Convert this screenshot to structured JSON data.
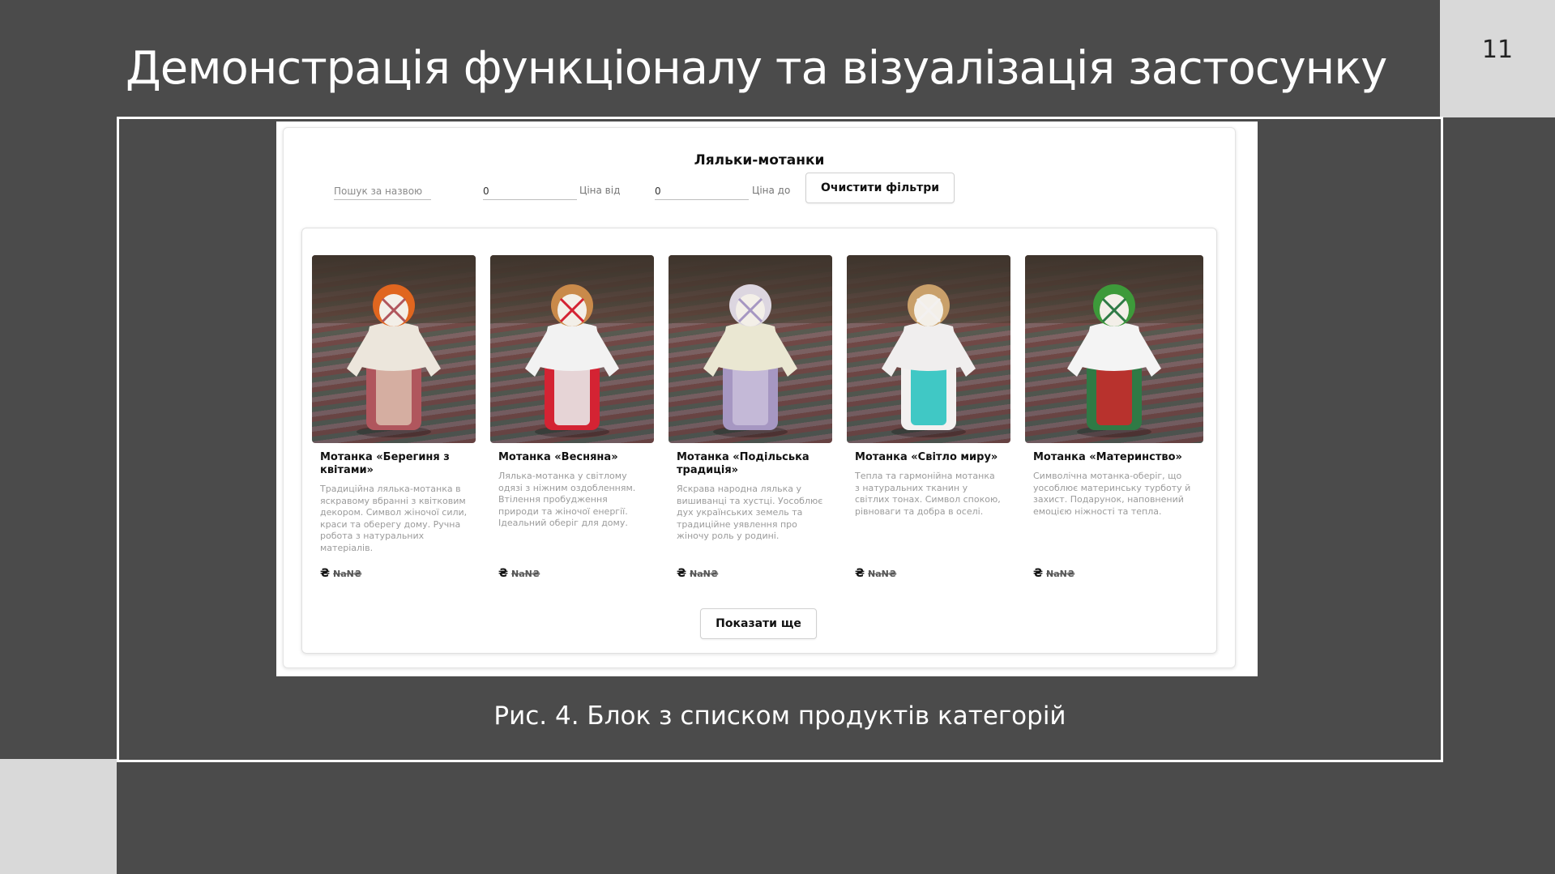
{
  "slide": {
    "title": "Демонстрація функціоналу та візуалізація застосунку",
    "number": "11",
    "caption": "Рис. 4. Блок з списком продуктів категорій"
  },
  "app": {
    "heading": "Ляльки-мотанки",
    "filters": {
      "search_placeholder": "Пошук за назвою",
      "price_from_value": "0",
      "price_from_label": "Ціна від",
      "price_to_value": "0",
      "price_to_label": "Ціна до",
      "clear_label": "Очистити фільтри"
    },
    "products": [
      {
        "name": "Мотанка «Берегиня з квітами»",
        "description": "Традиційна лялька-мотанка в яскравому вбранні з квітковим декором. Символ жіночої сили, краси та оберегу дому. Ручна робота з натуральних матеріалів.",
        "currency_icon": "₴",
        "price": "NaN₴",
        "colors": {
          "hair": "#e0661f",
          "top": "#ece6dc",
          "skirt": "#b0565d",
          "apron": "#d9b8a8"
        }
      },
      {
        "name": "Мотанка «Весняна»",
        "description": "Лялька-мотанка у світлому одязі з ніжним оздобленням. Втілення пробудження природи та жіночої енергії. Ідеальний оберіг для дому.",
        "currency_icon": "₴",
        "price": "NaN₴",
        "colors": {
          "hair": "#c98a4a",
          "top": "#f2f2f2",
          "skirt": "#d42333",
          "apron": "#e8e8e8"
        }
      },
      {
        "name": "Мотанка «Подільська традиція»",
        "description": "Яскрава народна лялька у вишиванці та хустці. Уособлює дух українських земель та традиційне уявлення про жіночу роль у родині.",
        "currency_icon": "₴",
        "price": "NaN₴",
        "colors": {
          "hair": "#dcd6e0",
          "top": "#eae7d2",
          "skirt": "#a697c2",
          "apron": "#c8bcd9"
        }
      },
      {
        "name": "Мотанка «Світло миру»",
        "description": "Тепла та гармонійна мотанка з натуральних тканин у світлих тонах. Символ спокою, рівноваги та добра в оселі.",
        "currency_icon": "₴",
        "price": "NaN₴",
        "colors": {
          "hair": "#c9a06a",
          "top": "#f0eeee",
          "skirt": "#f3f1f0",
          "apron": "#2cc3c0"
        }
      },
      {
        "name": "Мотанка «Материнство»",
        "description": "Символічна мотанка-оберіг, що уособлює материнську турботу й захист. Подарунок, наповнений емоцією ніжності та тепла.",
        "currency_icon": "₴",
        "price": "NaN₴",
        "colors": {
          "hair": "#3d9a3a",
          "top": "#f4f4f4",
          "skirt": "#2f7a45",
          "apron": "#c82a2a"
        }
      }
    ],
    "show_more_label": "Показати ще"
  }
}
